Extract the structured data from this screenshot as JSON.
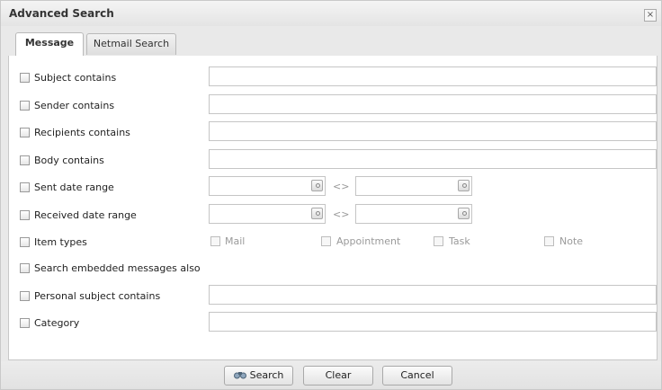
{
  "window": {
    "title": "Advanced Search",
    "close_glyph": "×"
  },
  "tabs": [
    {
      "label": "Message",
      "active": true
    },
    {
      "label": "Netmail Search",
      "active": false
    }
  ],
  "criteria": [
    {
      "label": "Subject contains",
      "value": ""
    },
    {
      "label": "Sender contains",
      "value": ""
    },
    {
      "label": "Recipients contains",
      "value": ""
    },
    {
      "label": "Body contains",
      "value": ""
    },
    {
      "label": "Sent date range",
      "from": "",
      "to": ""
    },
    {
      "label": "Received date range",
      "from": "",
      "to": ""
    },
    {
      "label": "Item types"
    },
    {
      "label": "Search embedded messages also"
    },
    {
      "label": "Personal subject contains",
      "value": ""
    },
    {
      "label": "Category",
      "value": ""
    }
  ],
  "date_separator": "<>",
  "item_types": [
    "Mail",
    "Appointment",
    "Task",
    "Note"
  ],
  "buttons": {
    "search": "Search",
    "clear": "Clear",
    "cancel": "Cancel"
  },
  "icons": {
    "search": "binoculars-icon",
    "calendar": "calendar-icon"
  },
  "colors": {
    "panel_bg": "#e9e9e9",
    "border": "#c5c5c5",
    "disabled_text": "#9a9a9a"
  }
}
